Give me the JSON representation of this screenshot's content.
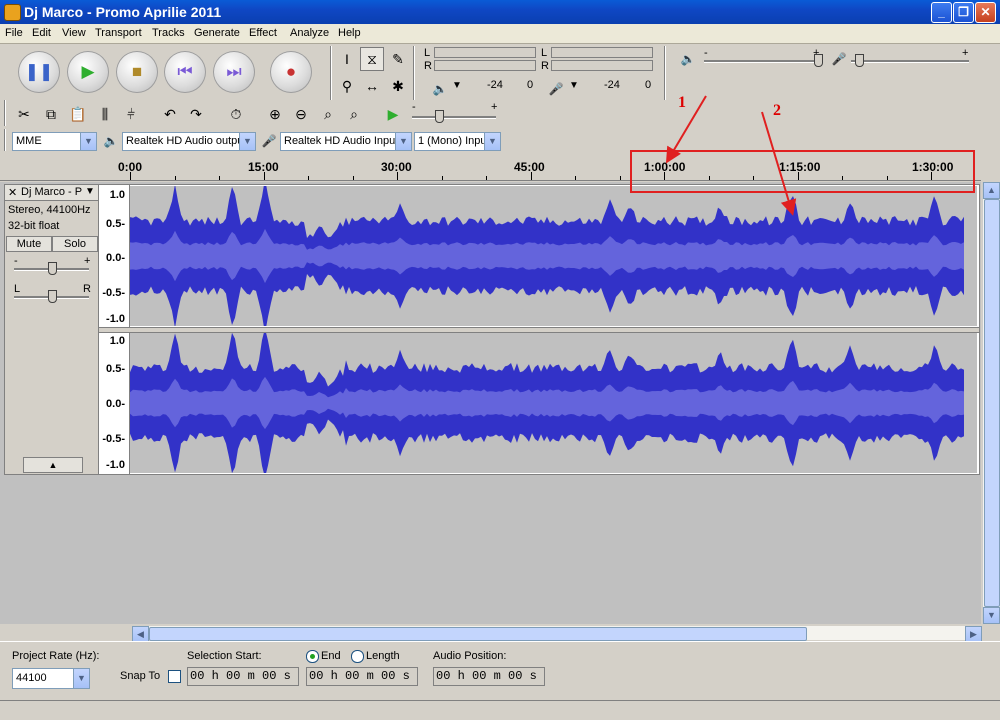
{
  "window": {
    "title": "Dj Marco - Promo Aprilie 2011"
  },
  "menu": [
    "File",
    "Edit",
    "View",
    "Transport",
    "Tracks",
    "Generate",
    "Effect",
    "Analyze",
    "Help"
  ],
  "meters": {
    "play_scale_a": "-24",
    "play_scale_b": "0",
    "rec_scale_a": "-24",
    "rec_scale_b": "0",
    "l": "L",
    "r": "R",
    "mixer_minus": "-",
    "mixer_plus": "+"
  },
  "device": {
    "host": "MME",
    "output": "Realtek HD Audio outpu",
    "input": "Realtek HD Audio Input",
    "channels": "1 (Mono) Inpu"
  },
  "timeline": {
    "labels": [
      "0:00",
      "15:00",
      "30:00",
      "45:00",
      "1:00:00",
      "1:15:00",
      "1:30:00"
    ]
  },
  "track": {
    "name": "Dj Marco - P",
    "info1": "Stereo, 44100Hz",
    "info2": "32-bit float",
    "mute": "Mute",
    "solo": "Solo",
    "gain_minus": "-",
    "gain_plus": "+",
    "pan_l": "L",
    "pan_r": "R",
    "yaxis": [
      "1.0",
      "0.5-",
      "0.0-",
      "-0.5-",
      "-1.0"
    ],
    "wave_color": "#3232c8",
    "rms_color": "#6464dc"
  },
  "annotations": [
    "1",
    "2"
  ],
  "bottom": {
    "project_rate_label": "Project Rate (Hz):",
    "project_rate": "44100",
    "snap_to": "Snap To",
    "selection_start": "Selection Start:",
    "end": "End",
    "length": "Length",
    "audio_position": "Audio Position:",
    "time_zero": "00 h 00 m 00 s"
  }
}
